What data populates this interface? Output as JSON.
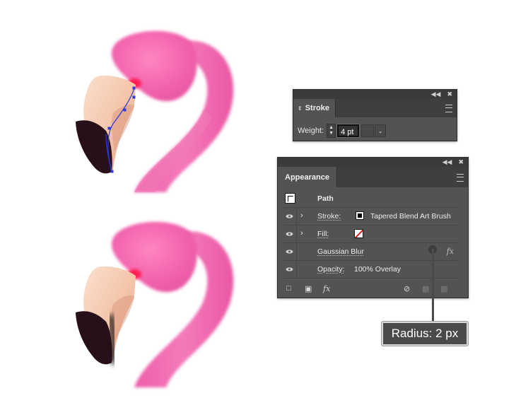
{
  "stroke_panel": {
    "tab_label": "Stroke",
    "weight_label": "Weight:",
    "weight_value": "4 pt"
  },
  "appearance_panel": {
    "tab_label": "Appearance",
    "path_label": "Path",
    "stroke_label": "Stroke:",
    "stroke_value": "Tapered Blend Art Brush",
    "fill_label": "Fill:",
    "effect_label": "Gaussian Blur",
    "opacity_label": "Opacity:",
    "opacity_value": "100% Overlay",
    "fx_glyph": "fx"
  },
  "callout": {
    "text": "Radius: 2 px"
  },
  "colors": {
    "flamingo_pink": "#f068b0",
    "beak_peach": "#f3c8b0",
    "beak_dark": "#2a1018",
    "eye_red": "#ff1a55",
    "anchor_blue": "#2f3ad8",
    "panel_bg": "#535353"
  }
}
